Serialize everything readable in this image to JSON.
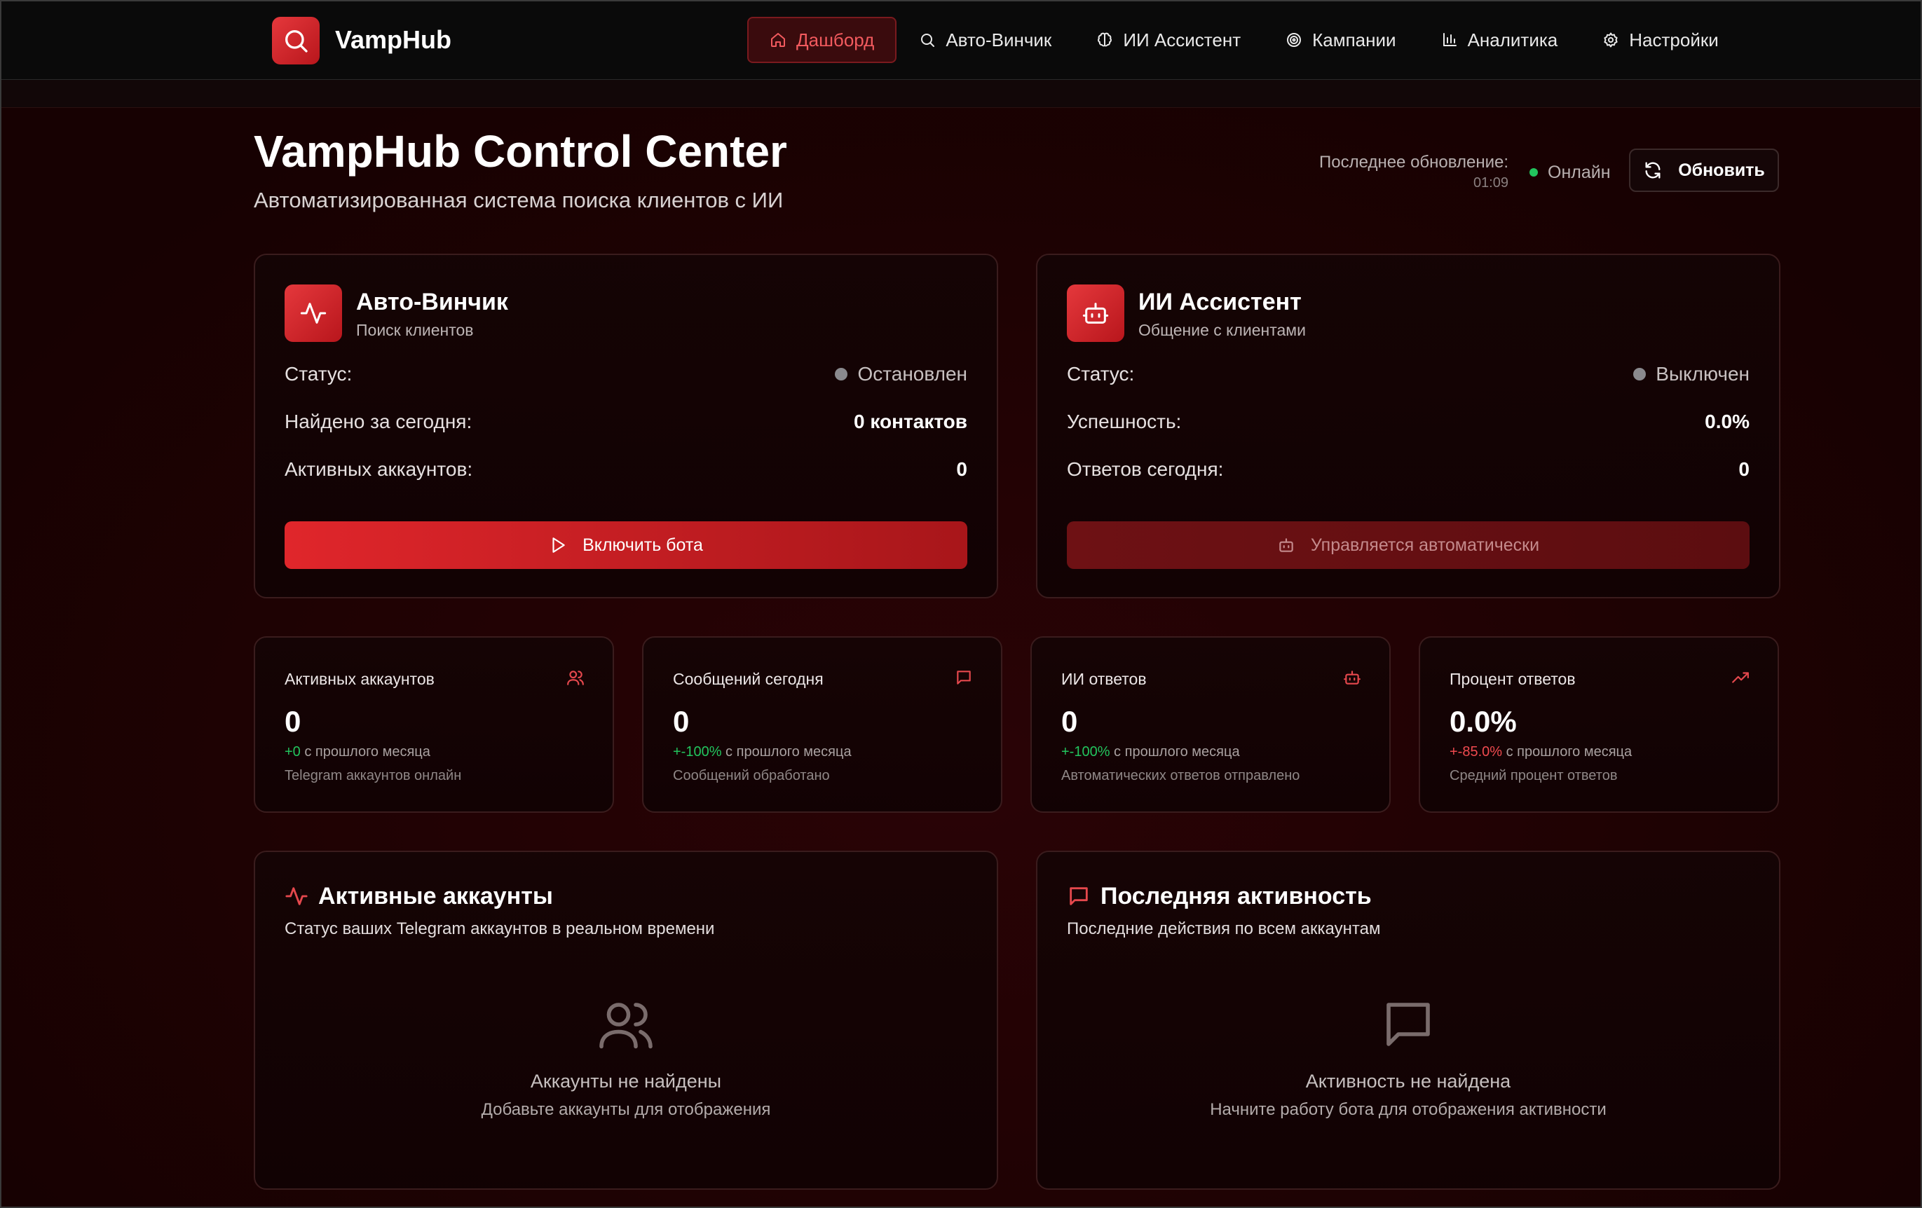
{
  "app": {
    "name": "VampHub"
  },
  "nav": {
    "items": [
      {
        "label": "Дашборд",
        "icon": "home-icon",
        "active": true
      },
      {
        "label": "Авто-Винчик",
        "icon": "search-icon",
        "active": false
      },
      {
        "label": "ИИ Ассистент",
        "icon": "brain-icon",
        "active": false
      },
      {
        "label": "Кампании",
        "icon": "target-icon",
        "active": false
      },
      {
        "label": "Аналитика",
        "icon": "bar-chart-icon",
        "active": false
      },
      {
        "label": "Настройки",
        "icon": "gear-icon",
        "active": false
      }
    ]
  },
  "header": {
    "title": "VampHub Control Center",
    "subtitle": "Автоматизированная система поиска клиентов с ИИ",
    "last_update_label": "Последнее обновление:",
    "last_update_time": "01:09",
    "status": "Онлайн",
    "refresh_label": "Обновить"
  },
  "bots": {
    "winchik": {
      "name": "Авто-Винчик",
      "subtitle": "Поиск клиентов",
      "rows": [
        {
          "label": "Статус:",
          "value": "Остановлен"
        },
        {
          "label": "Найдено за сегодня:",
          "value": "0 контактов"
        },
        {
          "label": "Активных аккаунтов:",
          "value": "0"
        }
      ],
      "button": "Включить бота"
    },
    "assistant": {
      "name": "ИИ Ассистент",
      "subtitle": "Общение с клиентами",
      "rows": [
        {
          "label": "Статус:",
          "value": "Выключен"
        },
        {
          "label": "Успешность:",
          "value": "0.0%"
        },
        {
          "label": "Ответов сегодня:",
          "value": "0"
        }
      ],
      "button": "Управляется автоматически"
    }
  },
  "stats": [
    {
      "title": "Активных аккаунтов",
      "icon": "users-icon",
      "value": "0",
      "change": "+0",
      "change_suffix": " с прошлого месяца",
      "desc": "Telegram аккаунтов онлайн"
    },
    {
      "title": "Сообщений сегодня",
      "icon": "message-icon",
      "value": "0",
      "change": "+-100%",
      "change_suffix": " с прошлого месяца",
      "desc": "Сообщений обработано"
    },
    {
      "title": "ИИ ответов",
      "icon": "bot-icon",
      "value": "0",
      "change": "+-100%",
      "change_suffix": " с прошлого месяца",
      "desc": "Автоматических ответов отправлено"
    },
    {
      "title": "Процент ответов",
      "icon": "trending-up-icon",
      "value": "0.0%",
      "change": "+-85.0%",
      "change_suffix": " с прошлого месяца",
      "desc": "Средний процент ответов"
    }
  ],
  "panels": {
    "accounts": {
      "title": "Активные аккаунты",
      "subtitle": "Статус ваших Telegram аккаунтов в реальном времени",
      "empty_title": "Аккаунты не найдены",
      "empty_sub": "Добавьте аккаунты для отображения"
    },
    "activity": {
      "title": "Последняя активность",
      "subtitle": "Последние действия по всем аккаунтам",
      "empty_title": "Активность не найдена",
      "empty_sub": "Начните работу бота для отображения активности"
    }
  },
  "colors": {
    "accent": "#e5383c",
    "positive": "#22c55e",
    "negative": "#ef4a4f",
    "background": "#1c0204"
  }
}
